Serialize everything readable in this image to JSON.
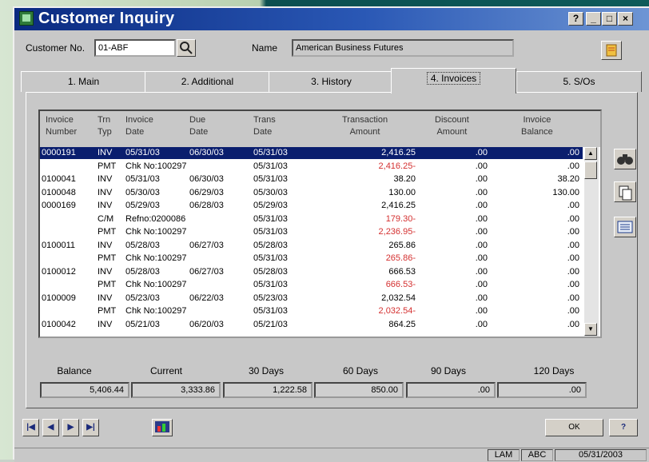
{
  "window": {
    "title": "Customer Inquiry",
    "help_btn": "?",
    "min_btn": "_",
    "max_btn": "□",
    "close_btn": "×"
  },
  "header": {
    "customer_label": "Customer No.",
    "customer_value": "01-ABF",
    "name_label": "Name",
    "name_value": "American Business Futures"
  },
  "tabs": [
    {
      "label": "1. Main"
    },
    {
      "label": "2. Additional"
    },
    {
      "label": "3. History"
    },
    {
      "label": "4. Invoices"
    },
    {
      "label": "5. S/Os"
    }
  ],
  "grid": {
    "columns": [
      {
        "l1": "Invoice",
        "l2": "Number"
      },
      {
        "l1": "Trn",
        "l2": "Typ"
      },
      {
        "l1": "Invoice",
        "l2": "Date"
      },
      {
        "l1": "Due",
        "l2": "Date"
      },
      {
        "l1": "Trans",
        "l2": "Date"
      },
      {
        "l1": "Transaction",
        "l2": "Amount"
      },
      {
        "l1": "Discount",
        "l2": "Amount"
      },
      {
        "l1": "Invoice",
        "l2": "Balance"
      }
    ],
    "rows": [
      {
        "inv": "0000191",
        "typ": "INV",
        "invdate": "05/31/03",
        "due": "06/30/03",
        "trans": "05/31/03",
        "amount": "2,416.25",
        "disc": ".00",
        "bal": ".00",
        "neg": false,
        "sel": true
      },
      {
        "inv": "",
        "typ": "PMT",
        "invdate": "Chk No:100297",
        "due": "",
        "trans": "05/31/03",
        "amount": "2,416.25-",
        "disc": ".00",
        "bal": ".00",
        "neg": true
      },
      {
        "inv": "0100041",
        "typ": "INV",
        "invdate": "05/31/03",
        "due": "06/30/03",
        "trans": "05/31/03",
        "amount": "38.20",
        "disc": ".00",
        "bal": "38.20",
        "neg": false
      },
      {
        "inv": "0100048",
        "typ": "INV",
        "invdate": "05/30/03",
        "due": "06/29/03",
        "trans": "05/30/03",
        "amount": "130.00",
        "disc": ".00",
        "bal": "130.00",
        "neg": false
      },
      {
        "inv": "0000169",
        "typ": "INV",
        "invdate": "05/29/03",
        "due": "06/28/03",
        "trans": "05/29/03",
        "amount": "2,416.25",
        "disc": ".00",
        "bal": ".00",
        "neg": false
      },
      {
        "inv": "",
        "typ": "C/M",
        "invdate": "Refno:0200086",
        "due": "",
        "trans": "05/31/03",
        "amount": "179.30-",
        "disc": ".00",
        "bal": ".00",
        "neg": true
      },
      {
        "inv": "",
        "typ": "PMT",
        "invdate": "Chk No:100297",
        "due": "",
        "trans": "05/31/03",
        "amount": "2,236.95-",
        "disc": ".00",
        "bal": ".00",
        "neg": true
      },
      {
        "inv": "0100011",
        "typ": "INV",
        "invdate": "05/28/03",
        "due": "06/27/03",
        "trans": "05/28/03",
        "amount": "265.86",
        "disc": ".00",
        "bal": ".00",
        "neg": false
      },
      {
        "inv": "",
        "typ": "PMT",
        "invdate": "Chk No:100297",
        "due": "",
        "trans": "05/31/03",
        "amount": "265.86-",
        "disc": ".00",
        "bal": ".00",
        "neg": true
      },
      {
        "inv": "0100012",
        "typ": "INV",
        "invdate": "05/28/03",
        "due": "06/27/03",
        "trans": "05/28/03",
        "amount": "666.53",
        "disc": ".00",
        "bal": ".00",
        "neg": false
      },
      {
        "inv": "",
        "typ": "PMT",
        "invdate": "Chk No:100297",
        "due": "",
        "trans": "05/31/03",
        "amount": "666.53-",
        "disc": ".00",
        "bal": ".00",
        "neg": true
      },
      {
        "inv": "0100009",
        "typ": "INV",
        "invdate": "05/23/03",
        "due": "06/22/03",
        "trans": "05/23/03",
        "amount": "2,032.54",
        "disc": ".00",
        "bal": ".00",
        "neg": false
      },
      {
        "inv": "",
        "typ": "PMT",
        "invdate": "Chk No:100297",
        "due": "",
        "trans": "05/31/03",
        "amount": "2,032.54-",
        "disc": ".00",
        "bal": ".00",
        "neg": true
      },
      {
        "inv": "0100042",
        "typ": "INV",
        "invdate": "05/21/03",
        "due": "06/20/03",
        "trans": "05/21/03",
        "amount": "864.25",
        "disc": ".00",
        "bal": ".00",
        "neg": false
      }
    ]
  },
  "aging": [
    {
      "label": "Balance",
      "value": "5,406.44"
    },
    {
      "label": "Current",
      "value": "3,333.86"
    },
    {
      "label": "30 Days",
      "value": "1,222.58"
    },
    {
      "label": "60 Days",
      "value": "850.00"
    },
    {
      "label": "90 Days",
      "value": ".00"
    },
    {
      "label": "120 Days",
      "value": ".00"
    }
  ],
  "buttons": {
    "ok": "OK",
    "help": "?"
  },
  "status": {
    "user": "LAM",
    "company": "ABC",
    "date": "05/31/2003"
  },
  "colors": {
    "title_start": "#0a2a80",
    "selection": "#0a1e6e",
    "negative": "#d43030"
  }
}
